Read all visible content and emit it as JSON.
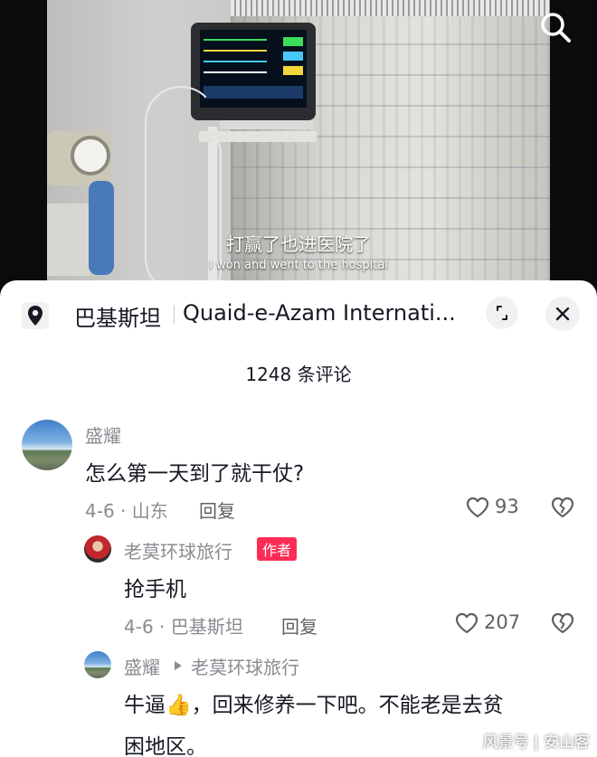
{
  "video": {
    "subtitle_cn": "打赢了也进医院了",
    "subtitle_en": "I won and went to the hospital"
  },
  "location": {
    "country": "巴基斯坦",
    "place": "Quaid-e-Azam Internati..."
  },
  "comments_header": {
    "count_label": "1248 条评论"
  },
  "comments": [
    {
      "user": "盛耀",
      "text": "怎么第一天到了就干仗?",
      "date_region": "4-6 · 山东",
      "reply_label": "回复",
      "likes": "93"
    },
    {
      "user": "老莫环球旅行",
      "badge": "作者",
      "text": "抢手机",
      "date_region": "4-6 · 巴基斯坦",
      "reply_label": "回复",
      "likes": "207"
    },
    {
      "user": "盛耀",
      "reply_to": "老莫环球旅行",
      "text_line1": "牛逼👍，回来修养一下吧。不能老是去贫",
      "text_line2": "困地区。"
    }
  ],
  "watermark": "风景号 | 安山客",
  "icons": {
    "search": "search-icon",
    "location": "location-pin-icon",
    "expand": "expand-icon",
    "close": "close-icon",
    "like": "heart-icon",
    "dislike": "broken-heart-icon",
    "reply_arrow": "reply-arrow-icon"
  },
  "colors": {
    "author_badge": "#fe2c55",
    "secondary_text": "#8a8b91"
  }
}
